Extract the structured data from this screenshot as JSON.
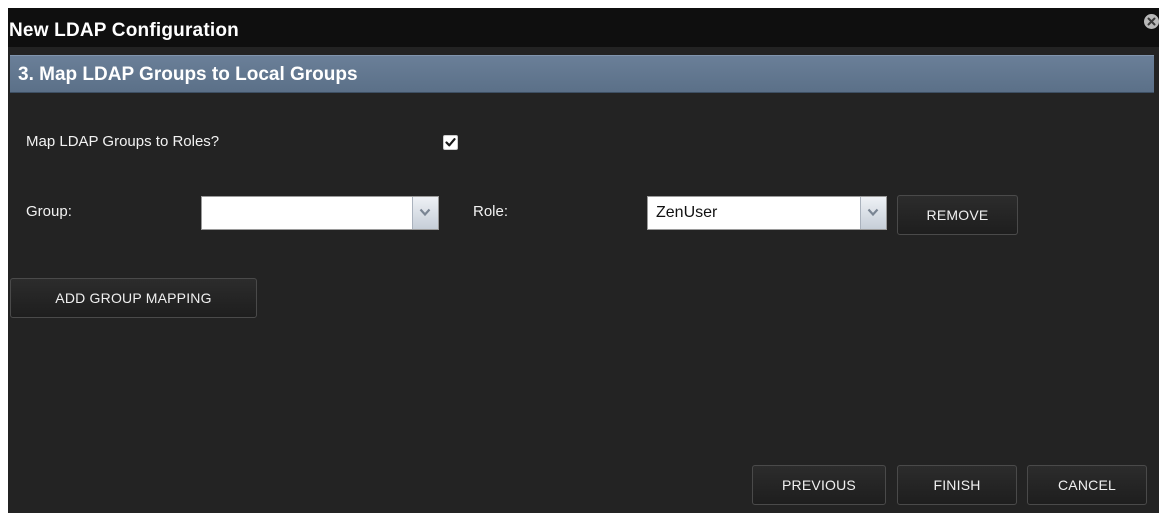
{
  "dialog": {
    "title": "New LDAP Configuration",
    "close_icon": "close-circle-icon"
  },
  "section": {
    "title": "3. Map LDAP Groups to Local Groups"
  },
  "form": {
    "map_groups_label": "Map LDAP Groups to Roles?",
    "map_groups_checked": true,
    "group_label": "Group:",
    "group_value": "",
    "role_label": "Role:",
    "role_value": "ZenUser",
    "remove_label": "REMOVE",
    "add_mapping_label": "ADD GROUP MAPPING"
  },
  "footer": {
    "previous_label": "PREVIOUS",
    "finish_label": "FINISH",
    "cancel_label": "CANCEL"
  },
  "colors": {
    "dialog_bg": "#232323",
    "titlebar_bg": "#0f0f0f",
    "section_header_bg": "#6a7f98"
  }
}
